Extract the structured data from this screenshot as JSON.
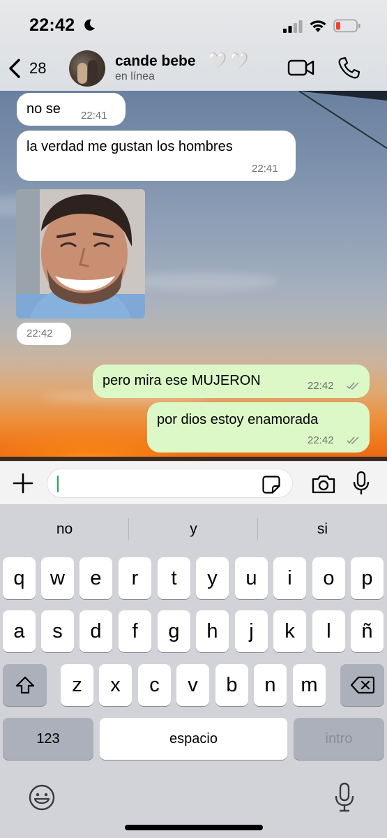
{
  "status_bar": {
    "time": "22:42"
  },
  "header": {
    "back_count": "28",
    "contact_name": "cande bebe",
    "contact_hearts": "🤍🤍",
    "contact_status": "en línea"
  },
  "messages": [
    {
      "direction": "in",
      "text": "no se",
      "time": "22:41"
    },
    {
      "direction": "in",
      "text": "la verdad me gustan los hombres",
      "time": "22:41"
    },
    {
      "direction": "in",
      "type": "image",
      "time": "22:42"
    },
    {
      "direction": "out",
      "text": "pero mira ese MUJERON",
      "time": "22:42",
      "status": "read"
    },
    {
      "direction": "out",
      "text": "por dios estoy enamorada",
      "time": "22:42",
      "status": "read"
    }
  ],
  "input": {
    "placeholder": ""
  },
  "keyboard": {
    "suggestions": [
      "no",
      "y",
      "si"
    ],
    "row1": [
      "q",
      "w",
      "e",
      "r",
      "t",
      "y",
      "u",
      "i",
      "o",
      "p"
    ],
    "row2": [
      "a",
      "s",
      "d",
      "f",
      "g",
      "h",
      "j",
      "k",
      "l",
      "ñ"
    ],
    "row3": [
      "z",
      "x",
      "c",
      "v",
      "b",
      "n",
      "m"
    ],
    "numbers_label": "123",
    "space_label": "espacio",
    "return_label": "intro"
  },
  "colors": {
    "outgoing_bubble": "#dbf8c6",
    "incoming_bubble": "#ffffff",
    "accent": "#1fa855"
  },
  "icons": [
    "moon-icon",
    "signal-icon",
    "wifi-icon",
    "battery-icon",
    "back-chevron-icon",
    "video-call-icon",
    "phone-icon",
    "plus-icon",
    "sticker-icon",
    "camera-icon",
    "microphone-icon",
    "shift-icon",
    "backspace-icon",
    "emoji-icon",
    "dictation-icon",
    "double-check-icon"
  ]
}
